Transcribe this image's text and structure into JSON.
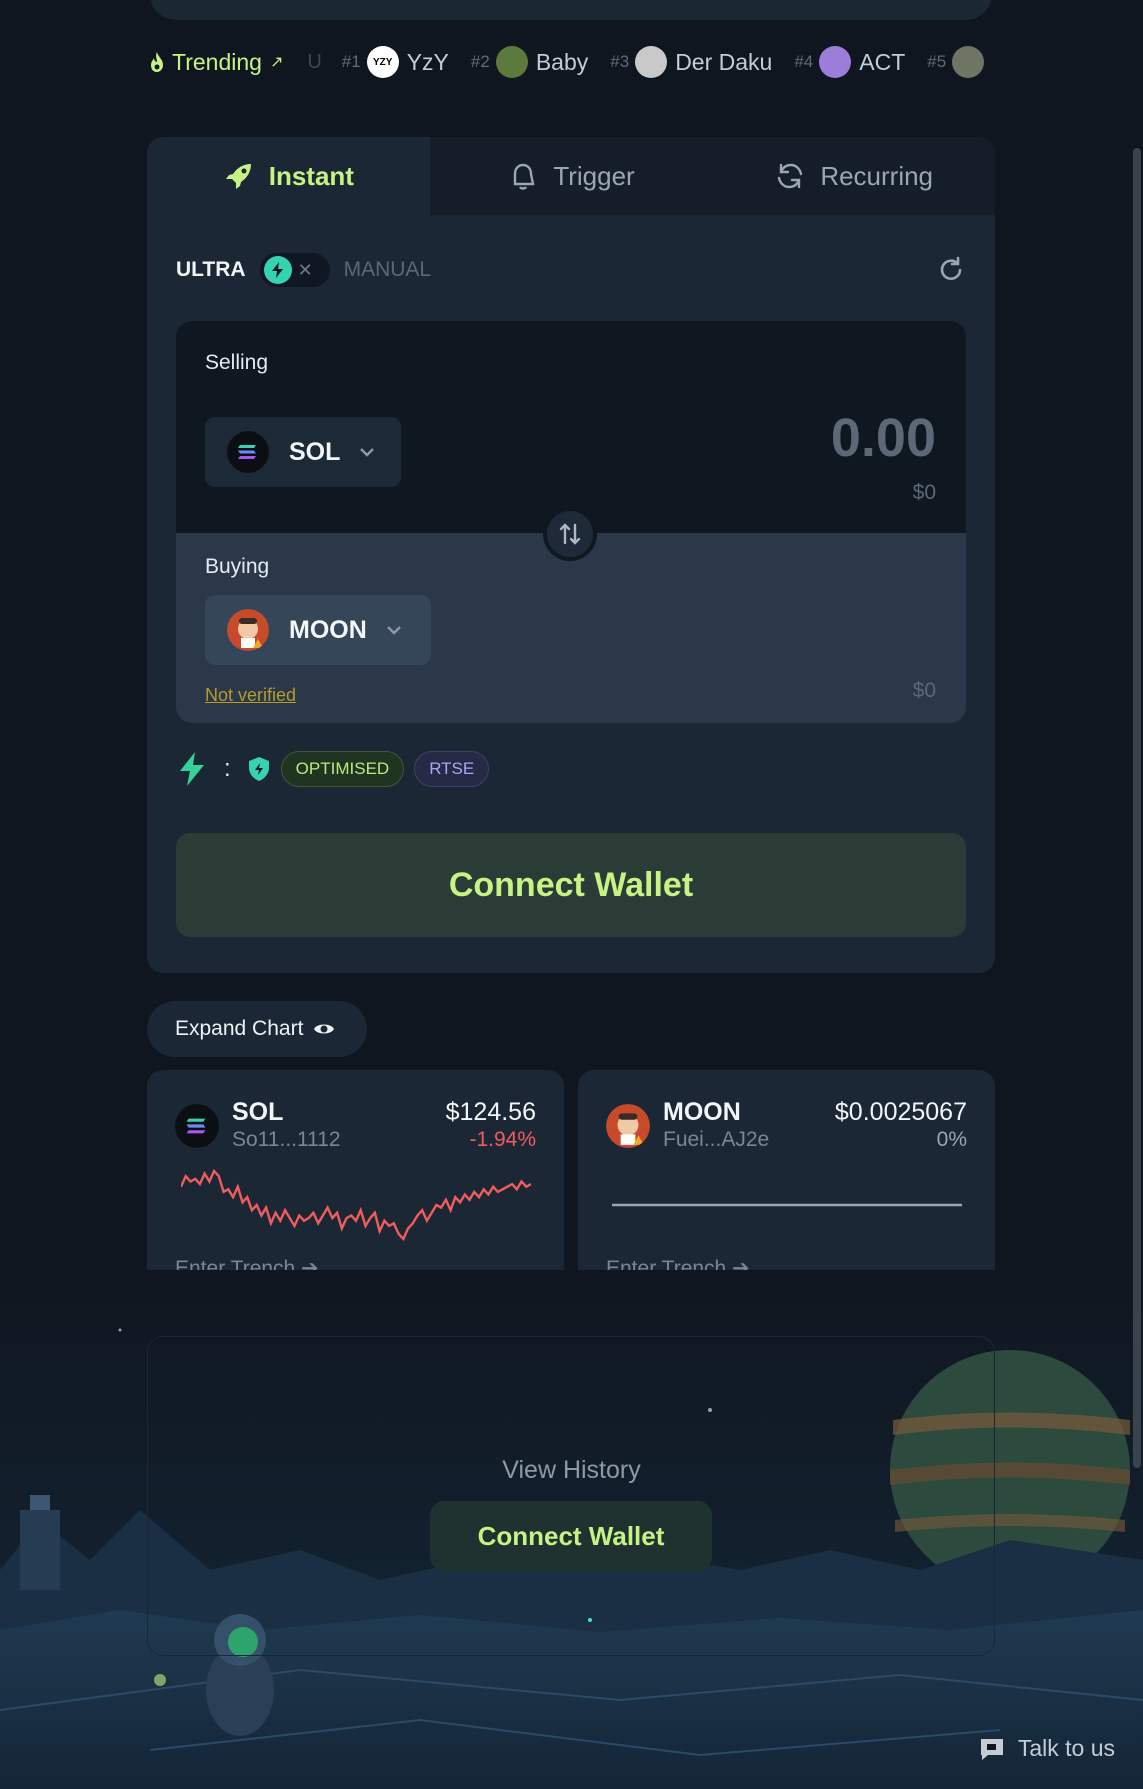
{
  "trending": {
    "label": "Trending",
    "arrow": "↗",
    "separator": "U",
    "items": [
      {
        "rank": "#1",
        "name": "YzY",
        "logo_text": "YZY",
        "color": "#ffffff"
      },
      {
        "rank": "#2",
        "name": "Baby",
        "color": "#5c7a3e"
      },
      {
        "rank": "#3",
        "name": "Der Daku",
        "color": "#c9c9c9"
      },
      {
        "rank": "#4",
        "name": "ACT",
        "color": "#9c7dd9"
      },
      {
        "rank": "#5",
        "name": "",
        "color": "#6f7563"
      }
    ]
  },
  "tabs": [
    {
      "label": "Instant",
      "icon": "rocket-icon",
      "active": true
    },
    {
      "label": "Trigger",
      "icon": "bell-icon",
      "active": false
    },
    {
      "label": "Recurring",
      "icon": "recurring-icon",
      "active": false
    }
  ],
  "mode": {
    "ultra": "ULTRA",
    "manual": "MANUAL"
  },
  "selling": {
    "label": "Selling",
    "token": "SOL",
    "amount": "0.00",
    "usd": "$0"
  },
  "buying": {
    "label": "Buying",
    "token": "MOON",
    "warning": "Not verified",
    "usd": "$0"
  },
  "route": {
    "colon": ":",
    "badges": [
      "OPTIMISED",
      "RTSE"
    ]
  },
  "connect_button": "Connect Wallet",
  "expand_chart": "Expand Chart",
  "cards": [
    {
      "symbol": "SOL",
      "address": "So11...1112",
      "price": "$124.56",
      "change": "-1.94%",
      "change_color": "#f05d5d",
      "spark_color": "#f05d5d",
      "enter": "Enter Trench ➔",
      "spark": [
        30,
        22,
        26,
        24,
        28,
        20,
        26,
        18,
        22,
        34,
        32,
        38,
        30,
        42,
        38,
        48,
        44,
        52,
        46,
        58,
        50,
        56,
        48,
        54,
        60,
        52,
        56,
        54,
        50,
        58,
        52,
        46,
        54,
        50,
        62,
        54,
        52,
        56,
        48,
        60,
        54,
        50,
        64,
        56,
        60,
        58,
        66,
        70,
        62,
        58,
        52,
        48,
        56,
        50,
        44,
        46,
        40,
        48,
        38,
        42,
        36,
        40,
        34,
        38,
        32,
        36,
        30,
        34,
        32,
        30,
        28,
        32,
        26,
        30,
        28
      ]
    },
    {
      "symbol": "MOON",
      "address": "Fuei...AJ2e",
      "price": "$0.0025067",
      "change": "0%",
      "change_color": "#9aa5b2",
      "spark_color": "#9aa5b2",
      "enter": "Enter Trench ➔",
      "spark": [
        40,
        40
      ]
    }
  ],
  "history": {
    "label": "View History",
    "connect": "Connect Wallet"
  },
  "talk": "Talk to us"
}
